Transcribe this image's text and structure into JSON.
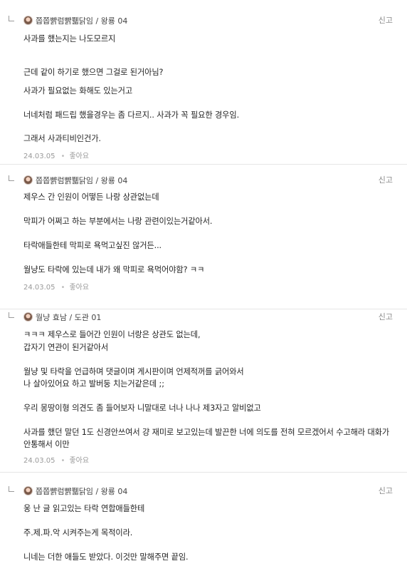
{
  "report_label": "신고",
  "like_label": "좋아요",
  "comments": [
    {
      "author": "쫍쫍뺡럼뺡쮋닭임 / 왕룡 04",
      "lines": [
        "사과를 했는지는 나도모르지",
        "근데 같이 하기로 했으면 그걸로 된거아님?",
        "사과가 필요없는 화해도 있는거고",
        "너네처럼 패드립 했을경우는 좀 다르지.. 사과가 꼭 필요한 경우임.",
        "그래서 사과티비인건가."
      ],
      "date": "24.03.05"
    },
    {
      "author": "쫍쫍뺡럼뺡쮋닭임 / 왕룡 04",
      "lines": [
        "제우스 간 인원이 어떻든 나랑 상관없는데",
        "막피가 어쩌고 하는 부분에서는 나랑 관련이있는거같아서.",
        "타락애들한테 막피로 욕먹고싶진 않거든...",
        "월냥도 타락에 있는데 내가 왜 막피로 욕먹어야함? ㅋㅋ"
      ],
      "date": "24.03.05"
    },
    {
      "author": "월냥 효남 / 도관 01",
      "lines": [
        "ㅋㅋㅋ 제우스로 들어간 인원이 너랑은 상관도 없는데,",
        "갑자기 연관이 된거같아서",
        "월냥 및 타락을 언급하며 댓글이며 게시판이며 언제적꺼를 긁어와서",
        "나 살아있어요 하고 발버둥 치는거같은데 ;;",
        "우리 몽땅이형 의견도 좀 들어보자 니말대로 너나 나나 제3자고 알비없고",
        "사과를 했던 말던 1도 신경안쓰여서 걍 재미로 보고있는데 발끈한 너에 의도를 전혀 모르겠어서 수고해라 대화가",
        "안통해서 이만"
      ],
      "date": "24.03.05"
    },
    {
      "author": "쫍쫍뺡럼뺡쮋닭임 / 왕룡 04",
      "lines": [
        "웅 난 글 읽고있는 타락 연합애들한테",
        "주.제.파.악 시켜주는게 목적이라.",
        "니네는 더한 애들도 받았다. 이것만 말해주면 끝임."
      ],
      "date": ""
    }
  ]
}
